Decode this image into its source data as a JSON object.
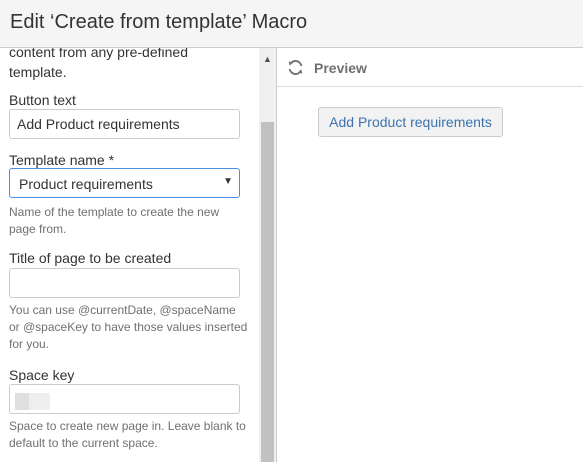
{
  "dialog": {
    "title": "Edit ‘Create from template’ Macro"
  },
  "form": {
    "intro_text_partial": "content from any pre-defined template.",
    "button_text": {
      "label": "Button text",
      "value": "Add Product requirements"
    },
    "template_name": {
      "label": "Template name *",
      "selected": "Product requirements",
      "help": "Name of the template to create the new page from."
    },
    "page_title": {
      "label": "Title of page to be created",
      "value": "",
      "help": "You can use @currentDate, @spaceName or @spaceKey to have those values inserted for you."
    },
    "space_key": {
      "label": "Space key",
      "help": "Space to create new page in. Leave blank to default to the current space."
    }
  },
  "preview": {
    "label": "Preview",
    "button_label": "Add Product requirements"
  },
  "icons": {
    "refresh": "refresh-icon",
    "caret": "caret-down-icon",
    "scroll_up": "scroll-up-arrow-icon"
  },
  "colors": {
    "header_bg": "#f5f5f5",
    "link_blue": "#3b73af",
    "focus_border": "#4a90e2",
    "help_text": "#707070"
  }
}
